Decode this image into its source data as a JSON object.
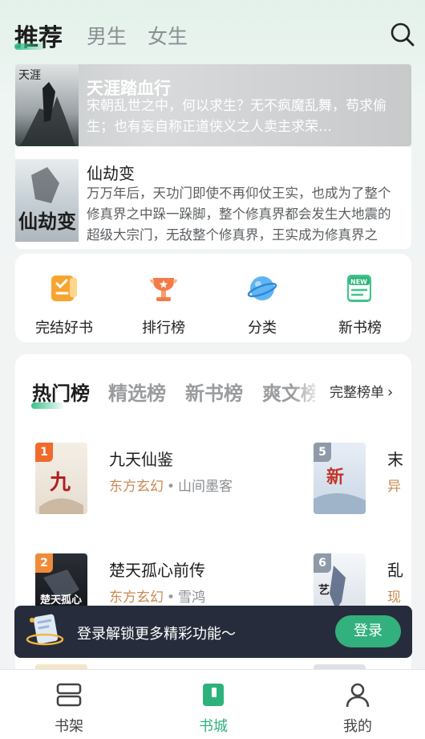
{
  "header": {
    "tabs": [
      {
        "label": "推荐",
        "active": true
      },
      {
        "label": "男生",
        "active": false
      },
      {
        "label": "女生",
        "active": false
      }
    ],
    "search_icon": "search-icon"
  },
  "featured": [
    {
      "title": "天涯踏血行",
      "description": "宋朝乱世之中，何以求生？无不疯魔乱舞，苟求偷生；也有妄自称正道侠义之人卖主求荣…",
      "cover_text": "天涯踏血行"
    },
    {
      "title": "仙劫变",
      "description": "万万年后，天功门即使不再仰仗王实，也成为了整个修真界之中跺一跺脚，整个修真界都会发生大地震的超级大宗门，无敌整个修真界，王实成为修真界之中…",
      "cover_text": "仙劫变"
    }
  ],
  "categories": [
    {
      "label": "完结好书",
      "icon": "book-check-icon"
    },
    {
      "label": "排行榜",
      "icon": "trophy-icon"
    },
    {
      "label": "分类",
      "icon": "planet-icon"
    },
    {
      "label": "新书榜",
      "icon": "new-book-icon"
    }
  ],
  "ranking": {
    "tabs": [
      "热门榜",
      "精选榜",
      "新书榜",
      "爽文榜"
    ],
    "full_list_label": "完整榜单",
    "books": [
      {
        "rank": "1",
        "title": "九天仙鉴",
        "genre": "东方玄幻",
        "author": "山间墨客",
        "badge_color": "#f06a2c"
      },
      {
        "rank": "5",
        "title": "末",
        "genre": "异",
        "author": "",
        "badge_color": "#8e9aa8"
      },
      {
        "rank": "2",
        "title": "楚天孤心前传",
        "genre": "东方玄幻",
        "author": "雪鸿",
        "badge_color": "#f08b3a"
      },
      {
        "rank": "6",
        "title": "乱",
        "genre": "现",
        "author": "",
        "badge_color": "#8e9aa8"
      }
    ]
  },
  "login_banner": {
    "text": "登录解锁更多精彩功能～",
    "button": "登录"
  },
  "bottom_nav": [
    {
      "label": "书架",
      "icon": "bookshelf-icon",
      "active": false
    },
    {
      "label": "书城",
      "icon": "bookstore-icon",
      "active": true
    },
    {
      "label": "我的",
      "icon": "profile-icon",
      "active": false
    }
  ],
  "colors": {
    "accent": "#32b07d",
    "genre": "#c98a54",
    "banner_bg": "#262c3b"
  }
}
